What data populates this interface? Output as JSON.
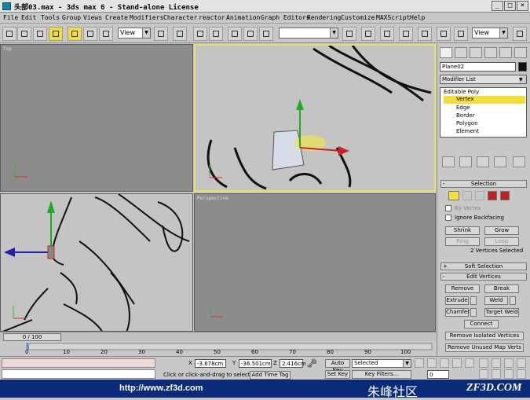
{
  "window": {
    "title": "头部03.max - 3ds max 6 - Stand-alone License"
  },
  "menu": [
    "File",
    "Edit",
    "Tools",
    "Group",
    "Views",
    "Create",
    "Modifiers",
    "Character",
    "reactor",
    "Animation",
    "Graph Editors",
    "Rendering",
    "Customize",
    "MAXScript",
    "Help"
  ],
  "toolbar": {
    "ref_coord": "View",
    "selection_set": "",
    "view_right": "View"
  },
  "viewports": {
    "top": "Top",
    "left": "",
    "front": "",
    "perspective": "Perspective"
  },
  "panel": {
    "object_name": "Plane02",
    "modifier_list": "Modifier List",
    "stack": [
      "Editable Poly",
      "Vertex",
      "Edge",
      "Border",
      "Polygon",
      "Element"
    ],
    "selection_title": "Selection",
    "by_vertex": "By Vertex",
    "ignore_backfacing": "Ignore Backfacing",
    "shrink": "Shrink",
    "grow": "Grow",
    "ring": "Ring",
    "loop": "Loop",
    "selected_info": "2 Vertices Selected",
    "soft_selection": "Soft Selection",
    "edit_vertices": "Edit Vertices",
    "remove": "Remove",
    "break": "Break",
    "extrude": "Extrude",
    "weld": "Weld",
    "chamfer": "Chamfer",
    "target_weld": "Target Weld",
    "connect": "Connect",
    "remove_isolated": "Remove Isolated Vertices",
    "remove_unused": "Remove Unused Map Verts"
  },
  "timeline": {
    "frame": "0 / 100",
    "ticks": [
      "0",
      "10",
      "20",
      "30",
      "40",
      "50",
      "60",
      "70",
      "80",
      "90",
      "100"
    ]
  },
  "status": {
    "x_label": "X",
    "x": "-3.678cm",
    "y_label": "Y",
    "y": "-36.501cm",
    "z_label": "Z",
    "z": "2.416cm",
    "auto_key": "Auto Key",
    "set_key": "Set Key",
    "selected": "Selected",
    "key_filters": "Key Filters...",
    "prompt": "Click or click-and-drag to select obj",
    "add_time_tag": "Add Time Tag",
    "frame_field": "0"
  },
  "watermark": {
    "url": "http://www.zf3d.com",
    "cn": "朱峰社区",
    "brand": "ZF3D.COM"
  },
  "colors": {
    "active_border": "#e8e060",
    "selection_yellow": "#f2de3a",
    "watermark_bg": "#0c2a7a"
  }
}
